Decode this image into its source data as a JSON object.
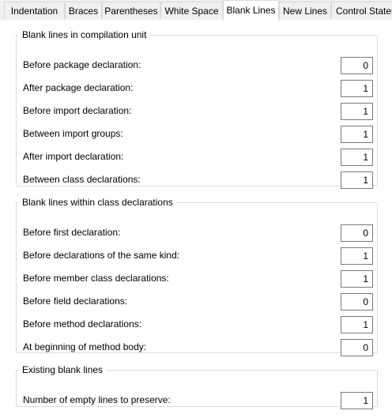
{
  "tabs": [
    {
      "label": "Indentation"
    },
    {
      "label": "Braces"
    },
    {
      "label": "Parentheses"
    },
    {
      "label": "White Space"
    },
    {
      "label": "Blank Lines"
    },
    {
      "label": "New Lines"
    },
    {
      "label": "Control Statements"
    }
  ],
  "active_tab": "Blank Lines",
  "compilation_unit": {
    "title": "Blank lines in compilation unit",
    "rows": [
      {
        "label": "Before package declaration:",
        "value": "0"
      },
      {
        "label": "After package declaration:",
        "value": "1"
      },
      {
        "label": "Before import declaration:",
        "value": "1"
      },
      {
        "label": "Between import groups:",
        "value": "1"
      },
      {
        "label": "After import declaration:",
        "value": "1"
      },
      {
        "label": "Between class declarations:",
        "value": "1"
      }
    ]
  },
  "class_declarations": {
    "title": "Blank lines within class declarations",
    "rows": [
      {
        "label": "Before first declaration:",
        "value": "0"
      },
      {
        "label": "Before declarations of the same kind:",
        "value": "1"
      },
      {
        "label": "Before member class declarations:",
        "value": "1"
      },
      {
        "label": "Before field declarations:",
        "value": "0"
      },
      {
        "label": "Before method declarations:",
        "value": "1"
      },
      {
        "label": "At beginning of method body:",
        "value": "0"
      }
    ]
  },
  "existing": {
    "title": "Existing blank lines",
    "rows": [
      {
        "label": "Number of empty lines to preserve:",
        "value": "1"
      }
    ]
  }
}
